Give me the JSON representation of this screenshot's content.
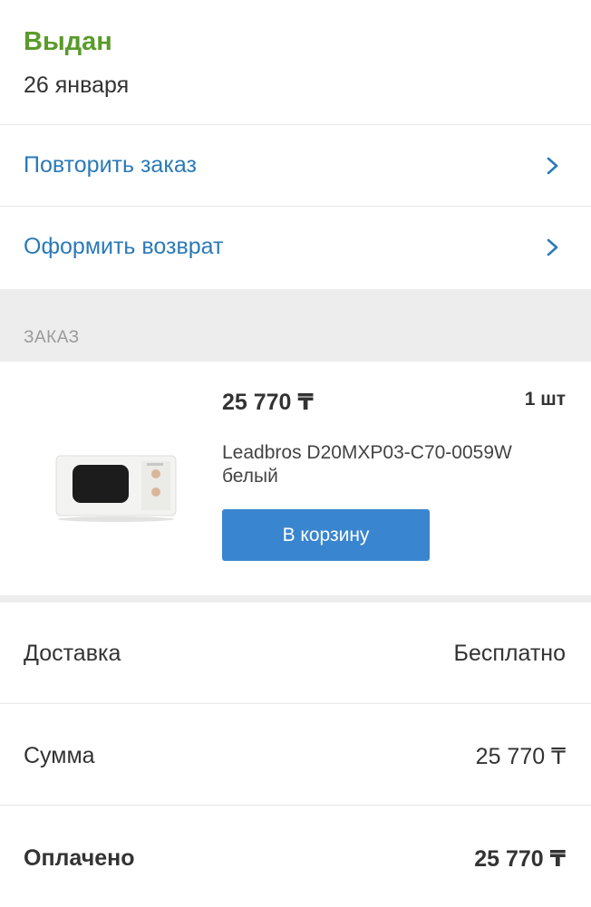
{
  "status": {
    "title": "Выдан",
    "date": "26 января"
  },
  "actions": [
    {
      "label": "Повторить заказ",
      "icon": "chevron-right-icon"
    },
    {
      "label": "Оформить возврат",
      "icon": "chevron-right-icon"
    }
  ],
  "section": {
    "label": "ЗАКАЗ"
  },
  "product": {
    "price": "25 770 ₸",
    "quantity": "1 шт",
    "name": "Leadbros D20MXP03-C70-0059W белый",
    "cart_button": "В корзину",
    "image": "microwave-oven-image"
  },
  "summary": [
    {
      "key": "Доставка",
      "value": "Бесплатно"
    },
    {
      "key": "Сумма",
      "value": "25 770 ₸"
    },
    {
      "key": "Оплачено",
      "value": "25 770 ₸"
    }
  ],
  "colors": {
    "status_green": "#5a9a2a",
    "link_blue": "#2a7ab8",
    "button_blue": "#3a85cf"
  }
}
